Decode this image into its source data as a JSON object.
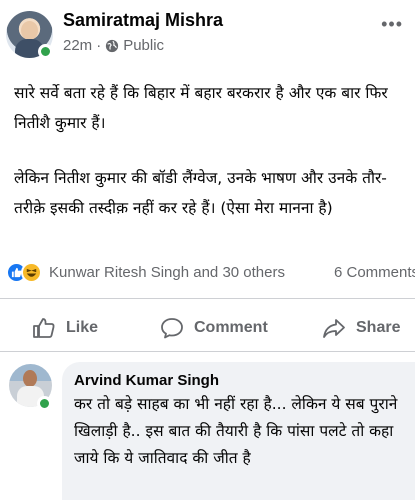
{
  "post": {
    "author": "Samiratmaj Mishra",
    "time": "22m",
    "separator": "·",
    "privacy": "Public",
    "more_label": "•••",
    "paragraph_1": "सारे सर्वे बता रहे हैं कि बिहार में बहार बरकरार है और एक बार फिर नितीशै कुमार हैं।",
    "paragraph_2": "लेकिन नितीश कुमार की बॉडी लैंग्वेज, उनके भाषण और उनके तौर-तरीक़े इसकी तस्दीक़ नहीं कर रहे हैं। (ऐसा मेरा मानना है)"
  },
  "reactions": {
    "icons": [
      "like-icon",
      "haha-icon"
    ],
    "names": "Kunwar Ritesh Singh and 30 others",
    "comments": "6 Comments"
  },
  "actions": {
    "like": "Like",
    "comment": "Comment",
    "share": "Share"
  },
  "comment": {
    "author": "Arvind Kumar Singh",
    "text": "कर तो बड़े साहब का भी नहीं रहा है... लेकिन ये सब पुराने खिलाड़ी है.. इस बात की तैयारी है कि पांसा पलटे तो कहा जाये कि ये जातिवाद की जीत है"
  },
  "colors": {
    "accent": "#1877f2",
    "online": "#31a24c",
    "muted_text": "#65676b",
    "comment_bubble": "#f0f2f5"
  }
}
